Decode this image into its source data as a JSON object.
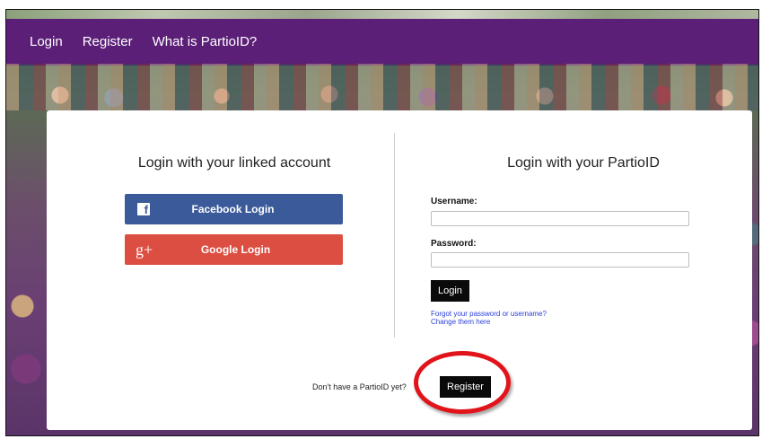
{
  "nav": {
    "items": [
      "Login",
      "Register",
      "What is PartioID?"
    ],
    "background_color": "#5b1f77"
  },
  "linked": {
    "title": "Login with your linked account",
    "facebook_label": "Facebook Login",
    "facebook_icon": "facebook-icon",
    "facebook_color": "#3b5a9a",
    "google_label": "Google Login",
    "google_icon_text": "g+",
    "google_color": "#dc4e41"
  },
  "partio": {
    "title": "Login with your PartioID",
    "username_label": "Username:",
    "username_value": "",
    "password_label": "Password:",
    "password_value": "",
    "login_label": "Login",
    "forgot_line1": "Forgot your password or username?",
    "forgot_line2": "Change them here"
  },
  "register": {
    "prompt": "Don't have a PartioID yet?",
    "button_label": "Register",
    "highlight_color": "#e0141a"
  }
}
